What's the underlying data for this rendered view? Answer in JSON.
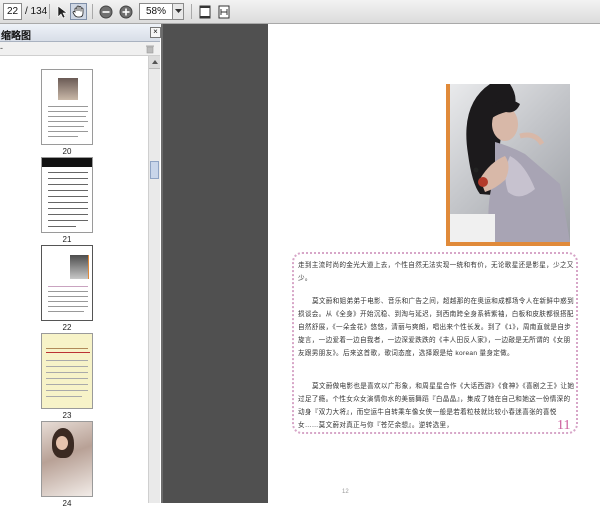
{
  "toolbar": {
    "page_current": "22",
    "page_total": "/ 134",
    "zoom_value": "58%"
  },
  "panel": {
    "title": "缩略图",
    "close_label": "×",
    "options_label": "-"
  },
  "thumbnails": [
    {
      "label": "20"
    },
    {
      "label": "21"
    },
    {
      "label": "22"
    },
    {
      "label": "23"
    },
    {
      "label": "24"
    }
  ],
  "page": {
    "paragraphs": [
      "走到主流时尚的金光大道上去，个性自然无法实现一统和有价，无论歌星还是影星，少之又少。",
      "莫文蔚和姐弟弟于电影、音乐和广告之间，超越那的在奥运和成都场令人在新鲜中惑到损谈会。从《全身》开始沉稳、到淘与延迟，到西南跨全身系裤紫袖，白板和皮肤都很搭配自然舒展，《一朵金花》悠悠，清丽与爽朗，唱出来个性长发。到了《1》，周南直就是自步旋言，一边爱着一边自我者，一边深爱跌跌的《丰人田反人家》，一边敲是无所谓的《女朋友跟男朋友》。后来这首歌，歌词态度，选择跟是给 korean 量身定做。",
      "莫文蔚做电影也是喜欢以广形象，和周星星合作《大话西游》《食神》《喜剧之王》让她过足了瘾。个性女众女演情你水的美丽舞蹈『白晶晶』，集成了她在自己和她这一份情深的动身『双力大将』，而空运牛自转乘车像女侠一般是若着粒枝就比较小春迷喜张的喜悦女……莫文蔚对真正与你『苍茫余想』。逆转选里，"
    ],
    "page_number": "11",
    "footer": "12"
  }
}
